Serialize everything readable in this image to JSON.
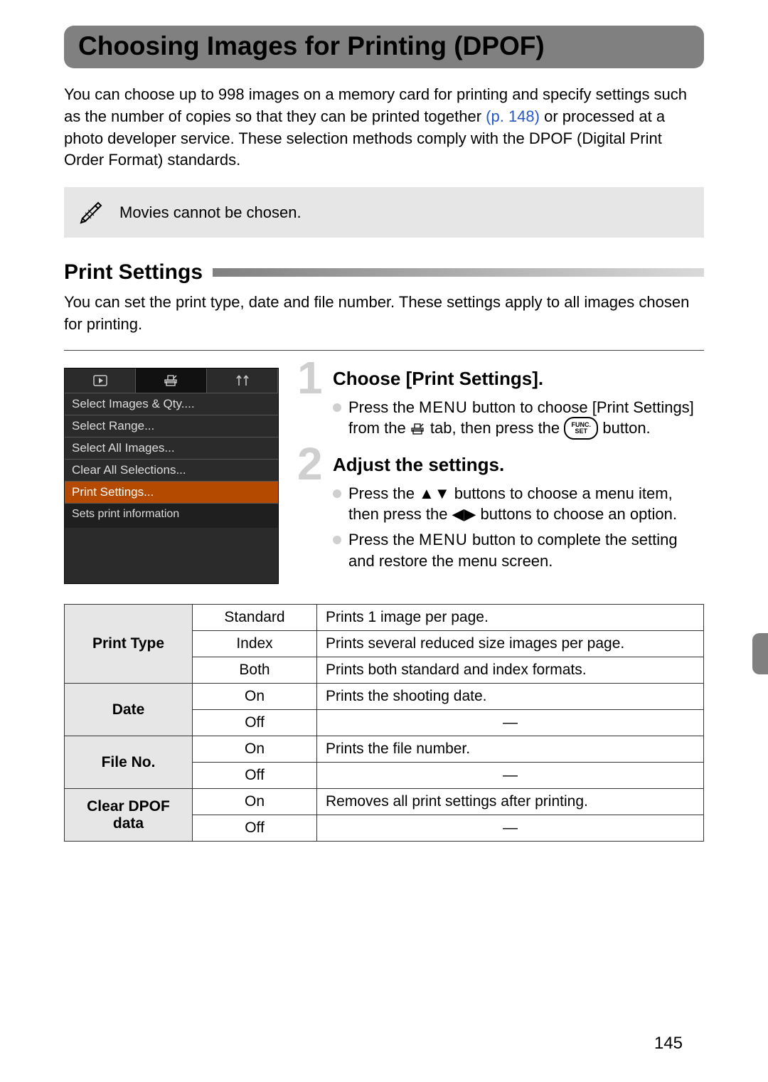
{
  "title": "Choosing Images for Printing (DPOF)",
  "intro": {
    "before_link": "You can choose up to 998 images on a memory card for printing and specify settings such as the number of copies so that they can be printed together ",
    "link": "(p. 148)",
    "after_link": " or processed at a photo developer service. These selection methods comply with the DPOF (Digital Print Order Format) standards."
  },
  "note": "Movies cannot be chosen.",
  "section": {
    "heading": "Print Settings",
    "desc": "You can set the print type, date and file number. These settings apply to all images chosen for printing."
  },
  "lcd": {
    "items": [
      "Select Images & Qty....",
      "Select Range...",
      "Select All Images...",
      "Clear All Selections...",
      "Print Settings..."
    ],
    "selected_index": 4,
    "hint": "Sets print information"
  },
  "steps": {
    "s1_title": "Choose [Print Settings].",
    "s1_b1a": "Press the ",
    "s1_b1_menu": "MENU",
    "s1_b1b": " button to choose [Print Settings] from the ",
    "s1_b1c": " tab, then press the ",
    "s1_b1d": " button.",
    "s2_title": "Adjust the settings.",
    "s2_b1a": "Press the ",
    "s2_b1b": " buttons to choose a menu item, then press the ",
    "s2_b1c": " buttons to choose an option.",
    "s2_b2a": "Press the ",
    "s2_b2_menu": "MENU",
    "s2_b2b": " button to complete the setting and restore the menu screen."
  },
  "table": {
    "cat1": "Print Type",
    "r1o": "Standard",
    "r1d": "Prints 1 image per page.",
    "r2o": "Index",
    "r2d": "Prints several reduced size images per page.",
    "r3o": "Both",
    "r3d": "Prints both standard and index formats.",
    "cat2": "Date",
    "r4o": "On",
    "r4d": "Prints the shooting date.",
    "r5o": "Off",
    "r5d": "—",
    "cat3": "File No.",
    "r6o": "On",
    "r6d": "Prints the file number.",
    "r7o": "Off",
    "r7d": "—",
    "cat4": "Clear DPOF data",
    "r8o": "On",
    "r8d": "Removes all print settings after printing.",
    "r9o": "Off",
    "r9d": "—"
  },
  "funcset_top": "FUNC.",
  "funcset_bot": "SET",
  "page_number": "145"
}
